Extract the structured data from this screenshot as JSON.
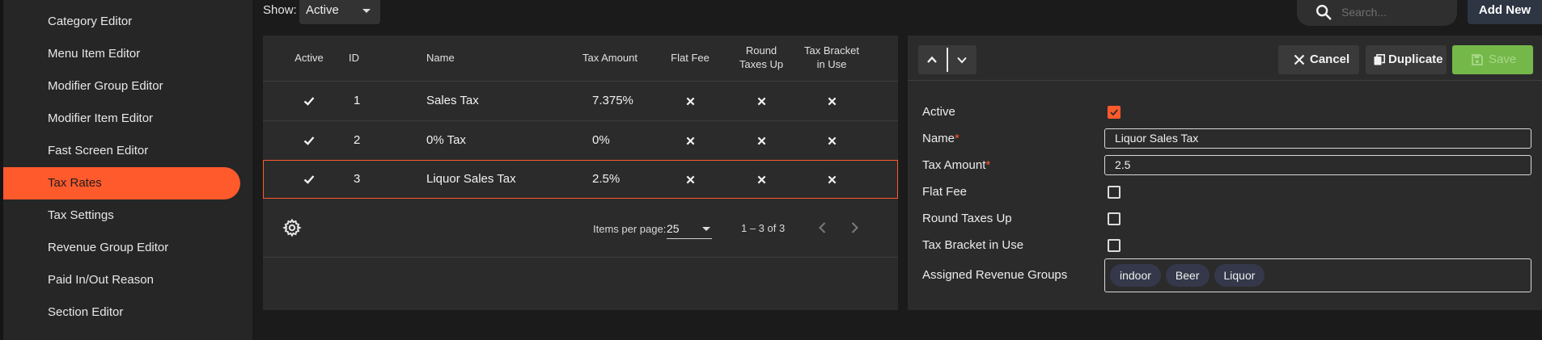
{
  "sidebar": {
    "items": [
      {
        "label": "Category Editor"
      },
      {
        "label": "Menu Item Editor"
      },
      {
        "label": "Modifier Group Editor"
      },
      {
        "label": "Modifier Item Editor"
      },
      {
        "label": "Fast Screen Editor"
      },
      {
        "label": "Tax Rates",
        "active": true
      },
      {
        "label": "Tax Settings"
      },
      {
        "label": "Revenue Group Editor"
      },
      {
        "label": "Paid In/Out Reason"
      },
      {
        "label": "Section Editor"
      }
    ]
  },
  "toolbar": {
    "show_label": "Show:",
    "show_value": "Active",
    "search_placeholder": "Search...",
    "add_new_label": "Add New"
  },
  "table": {
    "columns": {
      "active": "Active",
      "id": "ID",
      "name": "Name",
      "tax_amount": "Tax Amount",
      "flat_fee": "Flat Fee",
      "round_line1": "Round",
      "round_line2": "Taxes Up",
      "bracket_line1": "Tax Bracket",
      "bracket_line2": "in Use"
    },
    "rows": [
      {
        "active": true,
        "id": "1",
        "name": "Sales Tax",
        "tax_amount": "7.375%",
        "flat_fee": false,
        "round_up": false,
        "bracket": false
      },
      {
        "active": true,
        "id": "2",
        "name": "0% Tax",
        "tax_amount": "0%",
        "flat_fee": false,
        "round_up": false,
        "bracket": false
      },
      {
        "active": true,
        "id": "3",
        "name": "Liquor Sales Tax",
        "tax_amount": "2.5%",
        "flat_fee": false,
        "round_up": false,
        "bracket": false,
        "selected": true
      }
    ],
    "items_per_page_label": "Items per page:",
    "items_per_page": "25",
    "range_label": "1 – 3 of 3"
  },
  "detail": {
    "cancel_label": "Cancel",
    "duplicate_label": "Duplicate",
    "save_label": "Save",
    "fields": {
      "active_label": "Active",
      "active_value": true,
      "name_label": "Name",
      "name_value": "Liquor Sales Tax",
      "tax_amount_label": "Tax Amount",
      "tax_amount_value": "2.5",
      "required_marker": "*",
      "flat_fee_label": "Flat Fee",
      "flat_fee_value": false,
      "round_up_label": "Round Taxes Up",
      "round_up_value": false,
      "bracket_label": "Tax Bracket in Use",
      "bracket_value": false,
      "revenue_groups_label": "Assigned Revenue Groups",
      "revenue_groups": [
        "indoor",
        "Beer",
        "Liquor"
      ]
    }
  },
  "colors": {
    "accent": "#ff5a2c",
    "save_green": "#74b84a",
    "panel": "#2b2b2b",
    "background": "#1b1b1b"
  }
}
